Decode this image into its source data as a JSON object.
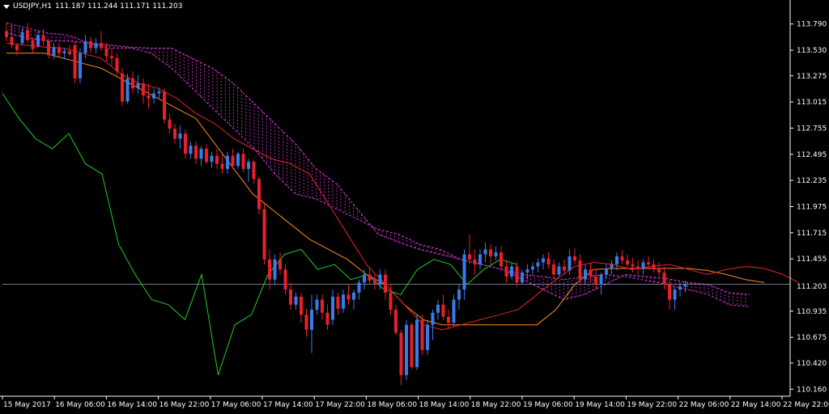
{
  "header": {
    "symbol": "USDJPY,H1",
    "ohlc": "111.187 111.244 111.171 111.203"
  },
  "colors": {
    "background": "#000000",
    "axis": "#ffffff",
    "bull_candle": "#3a7bea",
    "bear_candle": "#e8202a",
    "tenkan": "#e8202a",
    "kijun": "#ff8c1a",
    "chikou": "#22cc22",
    "cloud": "#d63bd6",
    "price_line": "#8fa3c8"
  },
  "chart_data": {
    "type": "candlestick",
    "indicator": "Ichimoku Kinko Hyo",
    "current_price": "111.203",
    "ylim": [
      110.09,
      113.9
    ],
    "y_ticks": [
      "113.790",
      "113.530",
      "113.275",
      "113.015",
      "112.755",
      "112.495",
      "112.235",
      "111.975",
      "111.715",
      "111.455",
      "111.203",
      "110.935",
      "110.675",
      "110.420",
      "110.160"
    ],
    "x_ticks": [
      "15 May 2017",
      "16 May 06:00",
      "16 May 14:00",
      "16 May 22:00",
      "17 May 06:00",
      "17 May 14:00",
      "17 May 22:00",
      "18 May 06:00",
      "18 May 14:00",
      "18 May 22:00",
      "19 May 06:00",
      "19 May 14:00",
      "19 May 22:00",
      "22 May 06:00",
      "22 May 14:00",
      "22 May 22:00"
    ],
    "candles": [
      [
        113.72,
        113.8,
        113.62,
        113.66
      ],
      [
        113.66,
        113.78,
        113.55,
        113.58
      ],
      [
        113.58,
        113.6,
        113.48,
        113.53
      ],
      [
        113.6,
        113.75,
        113.58,
        113.71
      ],
      [
        113.73,
        113.8,
        113.6,
        113.63
      ],
      [
        113.63,
        113.66,
        113.5,
        113.54
      ],
      [
        113.57,
        113.72,
        113.55,
        113.68
      ],
      [
        113.68,
        113.74,
        113.58,
        113.62
      ],
      [
        113.62,
        113.64,
        113.45,
        113.48
      ],
      [
        113.48,
        113.6,
        113.44,
        113.56
      ],
      [
        113.56,
        113.6,
        113.46,
        113.5
      ],
      [
        113.5,
        113.55,
        113.44,
        113.52
      ],
      [
        113.52,
        113.58,
        113.46,
        113.49
      ],
      [
        113.58,
        113.62,
        113.2,
        113.25
      ],
      [
        113.25,
        113.55,
        113.2,
        113.5
      ],
      [
        113.5,
        113.68,
        113.45,
        113.62
      ],
      [
        113.62,
        113.66,
        113.5,
        113.55
      ],
      [
        113.55,
        113.65,
        113.5,
        113.6
      ],
      [
        113.6,
        113.72,
        113.52,
        113.55
      ],
      [
        113.55,
        113.6,
        113.42,
        113.47
      ],
      [
        113.47,
        113.55,
        113.38,
        113.45
      ],
      [
        113.45,
        113.5,
        113.28,
        113.32
      ],
      [
        113.3,
        113.35,
        112.98,
        113.02
      ],
      [
        113.02,
        113.3,
        113.0,
        113.25
      ],
      [
        113.25,
        113.32,
        113.1,
        113.15
      ],
      [
        113.15,
        113.28,
        113.1,
        113.2
      ],
      [
        113.2,
        113.25,
        113.0,
        113.08
      ],
      [
        113.08,
        113.2,
        112.95,
        113.05
      ],
      [
        113.05,
        113.15,
        113.0,
        113.1
      ],
      [
        113.1,
        113.16,
        113.04,
        113.12
      ],
      [
        113.12,
        113.15,
        112.8,
        112.84
      ],
      [
        112.84,
        112.9,
        112.7,
        112.75
      ],
      [
        112.75,
        112.8,
        112.6,
        112.65
      ],
      [
        112.65,
        112.78,
        112.55,
        112.7
      ],
      [
        112.7,
        112.74,
        112.45,
        112.5
      ],
      [
        112.5,
        112.62,
        112.45,
        112.58
      ],
      [
        112.58,
        112.62,
        112.4,
        112.45
      ],
      [
        112.45,
        112.58,
        112.38,
        112.55
      ],
      [
        112.55,
        112.6,
        112.4,
        112.42
      ],
      [
        112.42,
        112.52,
        112.36,
        112.48
      ],
      [
        112.48,
        112.55,
        112.35,
        112.4
      ],
      [
        112.4,
        112.5,
        112.3,
        112.35
      ],
      [
        112.35,
        112.52,
        112.3,
        112.48
      ],
      [
        112.48,
        112.55,
        112.35,
        112.38
      ],
      [
        112.38,
        112.52,
        112.35,
        112.5
      ],
      [
        112.5,
        112.55,
        112.32,
        112.35
      ],
      [
        112.35,
        112.45,
        112.22,
        112.42
      ],
      [
        112.42,
        112.44,
        112.2,
        112.25
      ],
      [
        112.25,
        112.28,
        111.9,
        111.95
      ],
      [
        111.95,
        112.0,
        111.4,
        111.45
      ],
      [
        111.45,
        111.55,
        111.15,
        111.25
      ],
      [
        111.25,
        111.5,
        111.2,
        111.45
      ],
      [
        111.45,
        111.52,
        111.3,
        111.35
      ],
      [
        111.35,
        111.4,
        111.1,
        111.15
      ],
      [
        111.15,
        111.22,
        110.95,
        111.0
      ],
      [
        111.0,
        111.12,
        110.95,
        111.08
      ],
      [
        111.08,
        111.12,
        110.82,
        110.9
      ],
      [
        110.9,
        110.96,
        110.68,
        110.75
      ],
      [
        110.75,
        111.1,
        110.52,
        110.95
      ],
      [
        110.95,
        111.1,
        110.9,
        111.05
      ],
      [
        111.05,
        111.1,
        110.85,
        110.92
      ],
      [
        110.92,
        111.0,
        110.75,
        110.8
      ],
      [
        110.85,
        111.15,
        110.8,
        111.08
      ],
      [
        111.08,
        111.12,
        110.9,
        110.96
      ],
      [
        110.96,
        111.15,
        110.92,
        111.1
      ],
      [
        111.1,
        111.2,
        111.0,
        111.05
      ],
      [
        111.05,
        111.15,
        110.95,
        111.12
      ],
      [
        111.12,
        111.25,
        111.05,
        111.22
      ],
      [
        111.22,
        111.35,
        111.15,
        111.3
      ],
      [
        111.3,
        111.38,
        111.2,
        111.24
      ],
      [
        111.24,
        111.3,
        111.15,
        111.2
      ],
      [
        111.2,
        111.35,
        111.15,
        111.3
      ],
      [
        111.3,
        111.35,
        111.05,
        111.12
      ],
      [
        111.12,
        111.2,
        110.9,
        110.95
      ],
      [
        110.95,
        111.0,
        110.7,
        110.72
      ],
      [
        110.72,
        110.75,
        110.2,
        110.3
      ],
      [
        110.3,
        110.85,
        110.25,
        110.8
      ],
      [
        110.8,
        110.82,
        110.36,
        110.38
      ],
      [
        110.38,
        110.9,
        110.35,
        110.85
      ],
      [
        110.85,
        110.9,
        110.5,
        110.55
      ],
      [
        110.55,
        110.85,
        110.5,
        110.8
      ],
      [
        110.8,
        110.95,
        110.65,
        110.92
      ],
      [
        110.92,
        111.05,
        110.85,
        111.0
      ],
      [
        111.0,
        111.1,
        110.85,
        110.88
      ],
      [
        110.88,
        110.95,
        110.75,
        110.82
      ],
      [
        110.82,
        111.1,
        110.78,
        111.05
      ],
      [
        111.05,
        111.2,
        110.95,
        111.15
      ],
      [
        111.15,
        111.55,
        111.05,
        111.5
      ],
      [
        111.5,
        111.7,
        111.4,
        111.45
      ],
      [
        111.45,
        111.55,
        111.3,
        111.4
      ],
      [
        111.4,
        111.55,
        111.35,
        111.5
      ],
      [
        111.5,
        111.62,
        111.42,
        111.55
      ],
      [
        111.55,
        111.6,
        111.4,
        111.48
      ],
      [
        111.48,
        111.58,
        111.44,
        111.52
      ],
      [
        111.52,
        111.58,
        111.34,
        111.38
      ],
      [
        111.38,
        111.45,
        111.22,
        111.28
      ],
      [
        111.28,
        111.42,
        111.25,
        111.38
      ],
      [
        111.38,
        111.42,
        111.18,
        111.22
      ],
      [
        111.22,
        111.35,
        111.2,
        111.32
      ],
      [
        111.32,
        111.4,
        111.25,
        111.35
      ],
      [
        111.35,
        111.42,
        111.3,
        111.38
      ],
      [
        111.38,
        111.46,
        111.32,
        111.42
      ],
      [
        111.42,
        111.5,
        111.35,
        111.46
      ],
      [
        111.46,
        111.52,
        111.36,
        111.4
      ],
      [
        111.4,
        111.45,
        111.25,
        111.3
      ],
      [
        111.3,
        111.42,
        111.28,
        111.38
      ],
      [
        111.38,
        111.45,
        111.3,
        111.34
      ],
      [
        111.34,
        111.55,
        111.3,
        111.48
      ],
      [
        111.48,
        111.56,
        111.4,
        111.44
      ],
      [
        111.44,
        111.5,
        111.2,
        111.25
      ],
      [
        111.25,
        111.4,
        111.2,
        111.35
      ],
      [
        111.35,
        111.42,
        111.22,
        111.28
      ],
      [
        111.28,
        111.36,
        111.15,
        111.2
      ],
      [
        111.2,
        111.32,
        111.1,
        111.3
      ],
      [
        111.3,
        111.4,
        111.25,
        111.36
      ],
      [
        111.36,
        111.44,
        111.3,
        111.4
      ],
      [
        111.4,
        111.52,
        111.34,
        111.48
      ],
      [
        111.48,
        111.54,
        111.4,
        111.44
      ],
      [
        111.44,
        111.5,
        111.36,
        111.4
      ],
      [
        111.4,
        111.46,
        111.32,
        111.38
      ],
      [
        111.38,
        111.44,
        111.3,
        111.36
      ],
      [
        111.36,
        111.45,
        111.3,
        111.42
      ],
      [
        111.42,
        111.48,
        111.35,
        111.4
      ],
      [
        111.4,
        111.45,
        111.32,
        111.35
      ],
      [
        111.35,
        111.42,
        111.28,
        111.32
      ],
      [
        111.32,
        111.38,
        111.15,
        111.2
      ],
      [
        111.2,
        111.25,
        110.95,
        111.05
      ],
      [
        111.05,
        111.18,
        110.95,
        111.15
      ],
      [
        111.15,
        111.22,
        111.08,
        111.18
      ],
      [
        111.18,
        111.24,
        111.12,
        111.2
      ]
    ],
    "tenkan": [
      113.6,
      113.58,
      113.56,
      113.55,
      113.5,
      113.45,
      113.3,
      113.2,
      113.15,
      113.05,
      112.9,
      112.8,
      112.65,
      112.55,
      112.45,
      112.4,
      112.3,
      112.0,
      111.7,
      111.4,
      111.2,
      111.0,
      110.8,
      110.75,
      110.8,
      110.85,
      110.9,
      110.95,
      111.1,
      111.25,
      111.38,
      111.42,
      111.4,
      111.35,
      111.38,
      111.4,
      111.35,
      111.3,
      111.35,
      111.38,
      111.36,
      111.3,
      111.2
    ],
    "kijun": [
      113.5,
      113.5,
      113.5,
      113.45,
      113.4,
      113.35,
      113.25,
      113.15,
      113.05,
      112.95,
      112.85,
      112.6,
      112.35,
      112.1,
      111.95,
      111.8,
      111.65,
      111.55,
      111.45,
      111.3,
      111.2,
      111.0,
      110.85,
      110.8,
      110.8,
      110.8,
      110.8,
      110.8,
      110.8,
      110.95,
      111.2,
      111.35,
      111.36,
      111.36,
      111.36,
      111.36,
      111.36,
      111.34,
      111.3,
      111.25,
      111.22
    ],
    "chikou": [
      113.1,
      112.85,
      112.65,
      112.55,
      112.7,
      112.4,
      112.3,
      111.6,
      111.3,
      111.05,
      111.0,
      110.85,
      111.3,
      110.3,
      110.8,
      110.9,
      111.3,
      111.5,
      111.55,
      111.35,
      111.4,
      111.25,
      111.3,
      111.15,
      111.1,
      111.35,
      111.45,
      111.4,
      111.2,
      111.35,
      111.45,
      111.4
    ],
    "senkou_a": [
      113.7,
      113.65,
      113.62,
      113.62,
      113.6,
      113.58,
      113.56,
      113.55,
      113.55,
      113.45,
      113.35,
      113.2,
      113.0,
      112.8,
      112.6,
      112.35,
      112.2,
      111.95,
      111.7,
      111.62,
      111.55,
      111.5,
      111.45,
      111.4,
      111.35,
      111.25,
      111.15,
      111.05,
      111.1,
      111.2,
      111.3,
      111.28,
      111.26,
      111.22,
      111.2,
      111.12,
      111.1
    ],
    "senkou_b": [
      113.8,
      113.75,
      113.7,
      113.68,
      113.6,
      113.55,
      113.55,
      113.5,
      113.35,
      113.15,
      112.95,
      112.75,
      112.55,
      112.3,
      112.1,
      112.05,
      111.95,
      111.85,
      111.75,
      111.7,
      111.6,
      111.55,
      111.45,
      111.4,
      111.35,
      111.3,
      111.28,
      111.25,
      111.28,
      111.3,
      111.28,
      111.24,
      111.2,
      111.15,
      111.1,
      111.0,
      110.98
    ]
  }
}
